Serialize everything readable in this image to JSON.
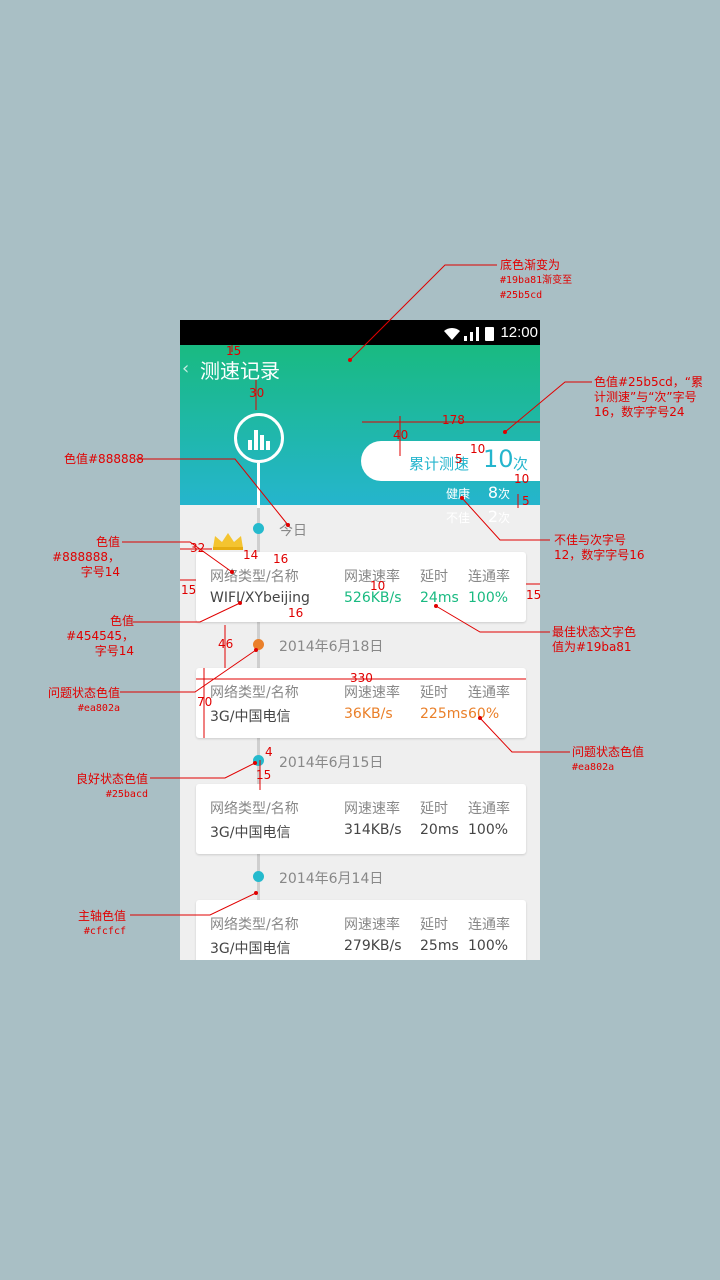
{
  "status_bar": {
    "time": "12:00"
  },
  "header": {
    "back_icon": "‹",
    "title": "测速记录",
    "summary_label": "累计测速",
    "summary_count": "10",
    "summary_unit": "次",
    "stats": [
      {
        "label": "健康",
        "count": "8",
        "unit": "次"
      },
      {
        "label": "不佳",
        "count": "2",
        "unit": "次"
      }
    ]
  },
  "columns": [
    "网络类型/名称",
    "网速速率",
    "延时",
    "连通率"
  ],
  "records": [
    {
      "date": "今日",
      "network": "WIFI/XYbeijing",
      "speed": "526KB/s",
      "latency": "24ms",
      "rate": "100%",
      "state": "best"
    },
    {
      "date": "2014年6月18日",
      "network": "3G/中国电信",
      "speed": "36KB/s",
      "latency": "225ms",
      "rate": "60%",
      "state": "problem"
    },
    {
      "date": "2014年6月15日",
      "network": "3G/中国电信",
      "speed": "314KB/s",
      "latency": "20ms",
      "rate": "100%",
      "state": "good"
    },
    {
      "date": "2014年6月14日",
      "network": "3G/中国电信",
      "speed": "279KB/s",
      "latency": "25ms",
      "rate": "100%",
      "state": "good"
    }
  ],
  "colors": {
    "gradient_start": "#19ba81",
    "gradient_end": "#25b5cd",
    "gray_text": "#888888",
    "dark_text": "#454545",
    "problem": "#ea802a",
    "good_dot": "#25bacd",
    "axis": "#cfcfcf"
  },
  "annotations": {
    "bg_gradient": {
      "line1": "底色渐变为",
      "line2": "#19ba81渐变至",
      "line3": "#25b5cd"
    },
    "summary_color": {
      "line1": "色值#25b5cd，“累",
      "line2": "计测速”与“次”字号",
      "line3": "16，数字字号24"
    },
    "color_888": "色值#888888",
    "date_color": {
      "line1": "色值#888888，",
      "line2": "字号14"
    },
    "stat_font": {
      "line1": "不佳与次字号",
      "line2": "12，数字字号16"
    },
    "value_color": {
      "line1": "色值#454545，",
      "line2": "字号14"
    },
    "best_color": {
      "line1": "最佳状态文字色",
      "line2": "值为#19ba81"
    },
    "problem_dot": {
      "line1": "问题状态色值",
      "line2": "#ea802a"
    },
    "problem_text": {
      "line1": "问题状态色值",
      "line2": "#ea802a"
    },
    "good_dot": {
      "line1": "良好状态色值",
      "line2": "#25bacd"
    },
    "axis_color": {
      "line1": "主轴色值",
      "line2": "#cfcfcf"
    }
  },
  "dimensions": [
    "15",
    "30",
    "178",
    "40",
    "10",
    "5",
    "10",
    "5",
    "32",
    "14",
    "16",
    "15",
    "10",
    "16",
    "15",
    "46",
    "330",
    "70",
    "4",
    "15"
  ]
}
